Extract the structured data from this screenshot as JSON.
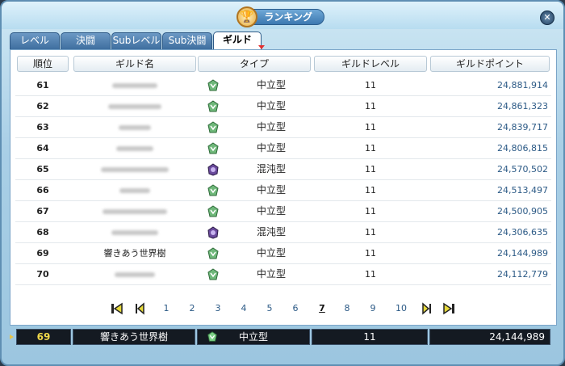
{
  "window": {
    "title": "ランキング"
  },
  "tabs": [
    {
      "label": "レベル"
    },
    {
      "label": "決闘"
    },
    {
      "label": "Subレベル"
    },
    {
      "label": "Sub決闘"
    },
    {
      "label": "ギルド"
    }
  ],
  "headers": {
    "rank": "順位",
    "guild": "ギルド名",
    "type": "タイプ",
    "level": "ギルドレベル",
    "points": "ギルドポイント"
  },
  "rows": [
    {
      "rank": "61",
      "guild": "",
      "type": "中立型",
      "type_icon": "neutral-icon",
      "level": "11",
      "points": "24,881,914"
    },
    {
      "rank": "62",
      "guild": "",
      "type": "中立型",
      "type_icon": "neutral-icon",
      "level": "11",
      "points": "24,861,323"
    },
    {
      "rank": "63",
      "guild": "",
      "type": "中立型",
      "type_icon": "neutral-icon",
      "level": "11",
      "points": "24,839,717"
    },
    {
      "rank": "64",
      "guild": "",
      "type": "中立型",
      "type_icon": "neutral-icon",
      "level": "11",
      "points": "24,806,815"
    },
    {
      "rank": "65",
      "guild": "",
      "type": "混沌型",
      "type_icon": "chaos-icon",
      "level": "11",
      "points": "24,570,502"
    },
    {
      "rank": "66",
      "guild": "",
      "type": "中立型",
      "type_icon": "neutral-icon",
      "level": "11",
      "points": "24,513,497"
    },
    {
      "rank": "67",
      "guild": "",
      "type": "中立型",
      "type_icon": "neutral-icon",
      "level": "11",
      "points": "24,500,905"
    },
    {
      "rank": "68",
      "guild": "",
      "type": "混沌型",
      "type_icon": "chaos-icon",
      "level": "11",
      "points": "24,306,635"
    },
    {
      "rank": "69",
      "guild": "響きあう世界樹",
      "type": "中立型",
      "type_icon": "neutral-icon",
      "level": "11",
      "points": "24,144,989"
    },
    {
      "rank": "70",
      "guild": "",
      "type": "中立型",
      "type_icon": "neutral-icon",
      "level": "11",
      "points": "24,112,779"
    }
  ],
  "pagination": {
    "pages": [
      "1",
      "2",
      "3",
      "4",
      "5",
      "6",
      "7",
      "8",
      "9",
      "10"
    ],
    "current": "7"
  },
  "my_guild": {
    "rank": "69",
    "guild": "響きあう世界樹",
    "type": "中立型",
    "type_icon": "neutral-icon",
    "level": "11",
    "points": "24,144,989"
  },
  "colors": {
    "neutral": "#6fb87a",
    "chaos": "#6a4a9c",
    "accent": "#2c5a86"
  }
}
